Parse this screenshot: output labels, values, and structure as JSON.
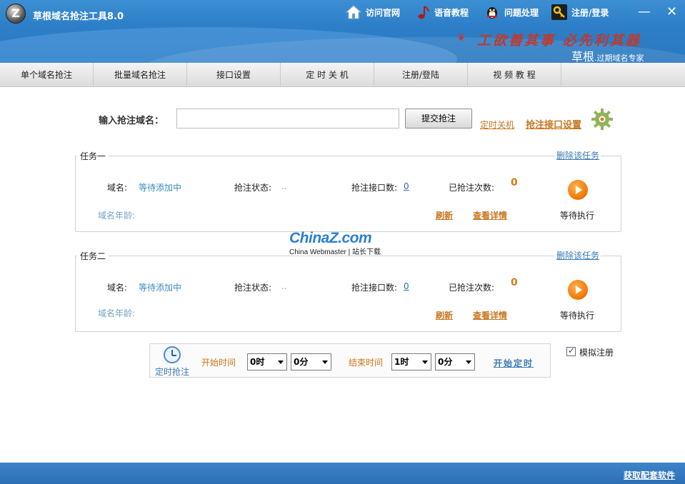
{
  "app": {
    "logo_letter": "Z",
    "title": "草根域名抢注工具8.0"
  },
  "topnav": [
    {
      "label": "访问官网",
      "icon": "home-icon"
    },
    {
      "label": "语音教程",
      "icon": "music-note-icon"
    },
    {
      "label": "问题处理",
      "icon": "qq-penguin-icon"
    },
    {
      "label": "注册/登录",
      "icon": "key-icon"
    }
  ],
  "window": {
    "minimize": "—",
    "close": "✕"
  },
  "banner": {
    "slogan": "工欲善其事 必先利其器",
    "brand": "草根",
    "brand_sub": ".过期域名专家"
  },
  "tabs": [
    "单个域名抢注",
    "批量域名抢注",
    "接口设置",
    "定 时 关 机",
    "注册/登陆",
    "视 频 教 程"
  ],
  "input_row": {
    "label": "输入抢注域名：",
    "value": "",
    "placeholder": "",
    "submit": "提交抢注",
    "timer_shutdown": "定时关机",
    "interface_settings": "抢注接口设置"
  },
  "tasks": [
    {
      "title": "任务一",
      "delete": "删除该任务",
      "domain_label": "域名:",
      "domain_value": "等待添加中",
      "status_label": "抢注状态:",
      "status_value": "..",
      "iface_label": "抢注接口数:",
      "iface_value": "0",
      "count_label": "已抢注次数:",
      "count_value": "0",
      "age_label": "域名年龄:",
      "refresh": "刷新",
      "details": "查看详情",
      "state": "等待执行"
    },
    {
      "title": "任务二",
      "delete": "删除该任务",
      "domain_label": "域名:",
      "domain_value": "等待添加中",
      "status_label": "抢注状态:",
      "status_value": "..",
      "iface_label": "抢注接口数:",
      "iface_value": "0",
      "count_label": "已抢注次数:",
      "count_value": "0",
      "age_label": "域名年龄:",
      "refresh": "刷新",
      "details": "查看详情",
      "state": "等待执行"
    }
  ],
  "watermark": {
    "text": "ChinaZ.com",
    "sub": "China Webmaster | 站长下载"
  },
  "schedule": {
    "label": "定时抢注",
    "start_label": "开始时间",
    "start_hour": "0时",
    "start_min": "0分",
    "end_label": "结束时间",
    "end_hour": "1时",
    "end_min": "0分",
    "start_button": "开始定时"
  },
  "simulate": {
    "label": "模拟注册",
    "checked": true
  },
  "footer": {
    "link": "获取配套软件"
  },
  "colors": {
    "title_blue": "#2d7fc8",
    "accent_orange": "#c9761f",
    "link_blue": "#3a79b7"
  }
}
